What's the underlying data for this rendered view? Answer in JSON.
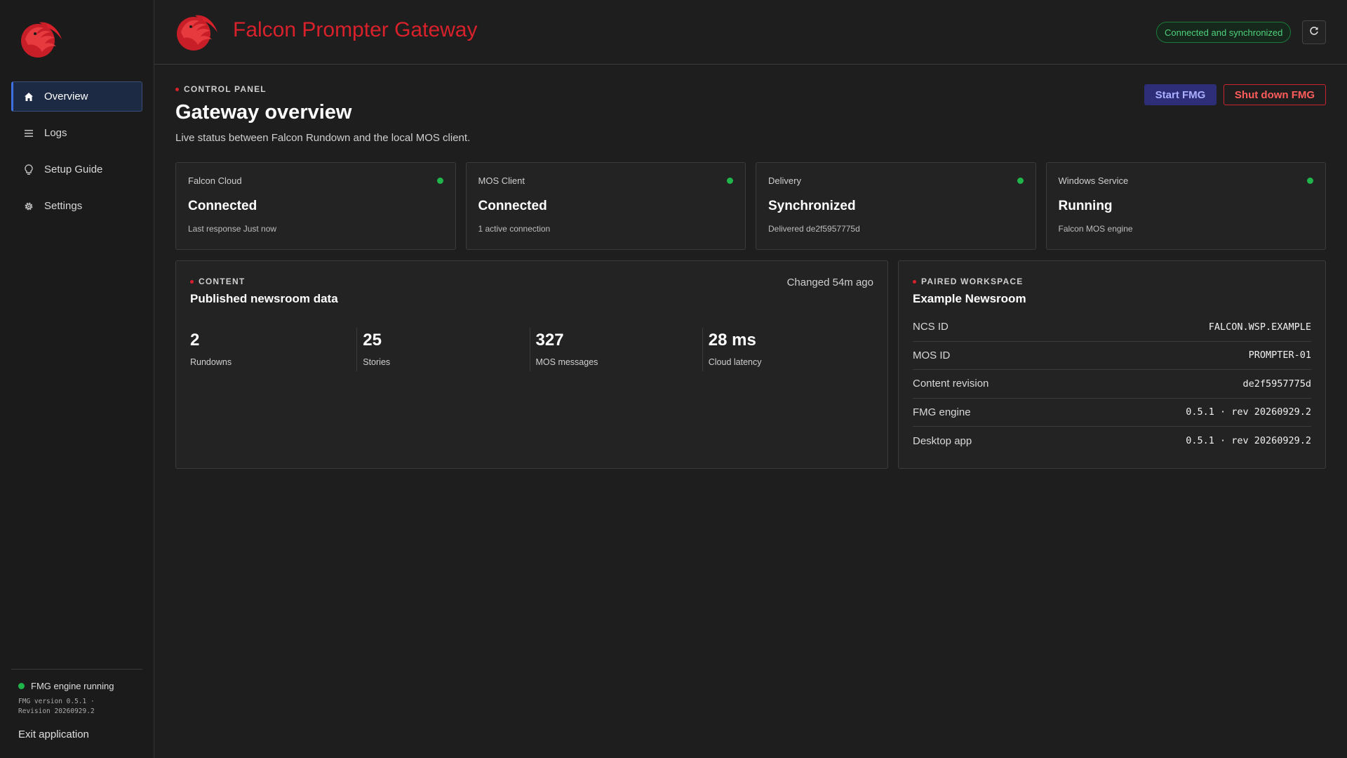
{
  "colors": {
    "brand_red": "#d8212b",
    "status_green": "#1fb54b",
    "accent_blue": "#3d6fe0"
  },
  "sidebar": {
    "logo_icon": "falcon-logo",
    "items": [
      {
        "label": "Overview",
        "icon": "home-icon",
        "active": true
      },
      {
        "label": "Logs",
        "icon": "list-icon"
      },
      {
        "label": "Setup Guide",
        "icon": "lightbulb-icon"
      },
      {
        "label": "Settings",
        "icon": "gear-icon"
      }
    ],
    "engine_status": "FMG engine running",
    "engine_version": "FMG version 0.5.1 · Revision 20260929.2",
    "exit_label": "Exit application"
  },
  "header": {
    "title": "Falcon Prompter Gateway",
    "status_badge": "Connected and synchronized",
    "refresh_icon": "refresh-icon"
  },
  "main": {
    "section_tag": "CONTROL PANEL",
    "title": "Gateway overview",
    "subtitle": "Live status between Falcon Rundown and the local MOS client.",
    "start_label": "Start FMG",
    "shutdown_label": "Shut down FMG",
    "cards": [
      {
        "label": "Falcon Cloud",
        "value": "Connected",
        "sub": "Last response Just now",
        "status": "green"
      },
      {
        "label": "MOS Client",
        "value": "Connected",
        "sub": "1 active connection",
        "status": "green"
      },
      {
        "label": "Delivery",
        "value": "Synchronized",
        "sub": "Delivered de2f5957775d",
        "status": "green"
      },
      {
        "label": "Windows Service",
        "value": "Running",
        "sub": "Falcon MOS engine",
        "status": "green"
      }
    ],
    "content": {
      "tag": "CONTENT",
      "title": "Published newsroom data",
      "changed": "Changed 54m ago",
      "stats": [
        {
          "value": "2",
          "label": "Rundowns"
        },
        {
          "value": "25",
          "label": "Stories"
        },
        {
          "value": "327",
          "label": "MOS messages"
        },
        {
          "value": "28 ms",
          "label": "Cloud latency"
        }
      ]
    },
    "workspace": {
      "tag": "PAIRED WORKSPACE",
      "title": "Example Newsroom",
      "rows": [
        {
          "key": "NCS ID",
          "value": "FALCON.WSP.EXAMPLE"
        },
        {
          "key": "MOS ID",
          "value": "PROMPTER-01"
        },
        {
          "key": "Content revision",
          "value": "de2f5957775d"
        },
        {
          "key": "FMG engine",
          "value": "0.5.1 · rev 20260929.2"
        },
        {
          "key": "Desktop app",
          "value": "0.5.1 · rev 20260929.2"
        }
      ]
    }
  }
}
